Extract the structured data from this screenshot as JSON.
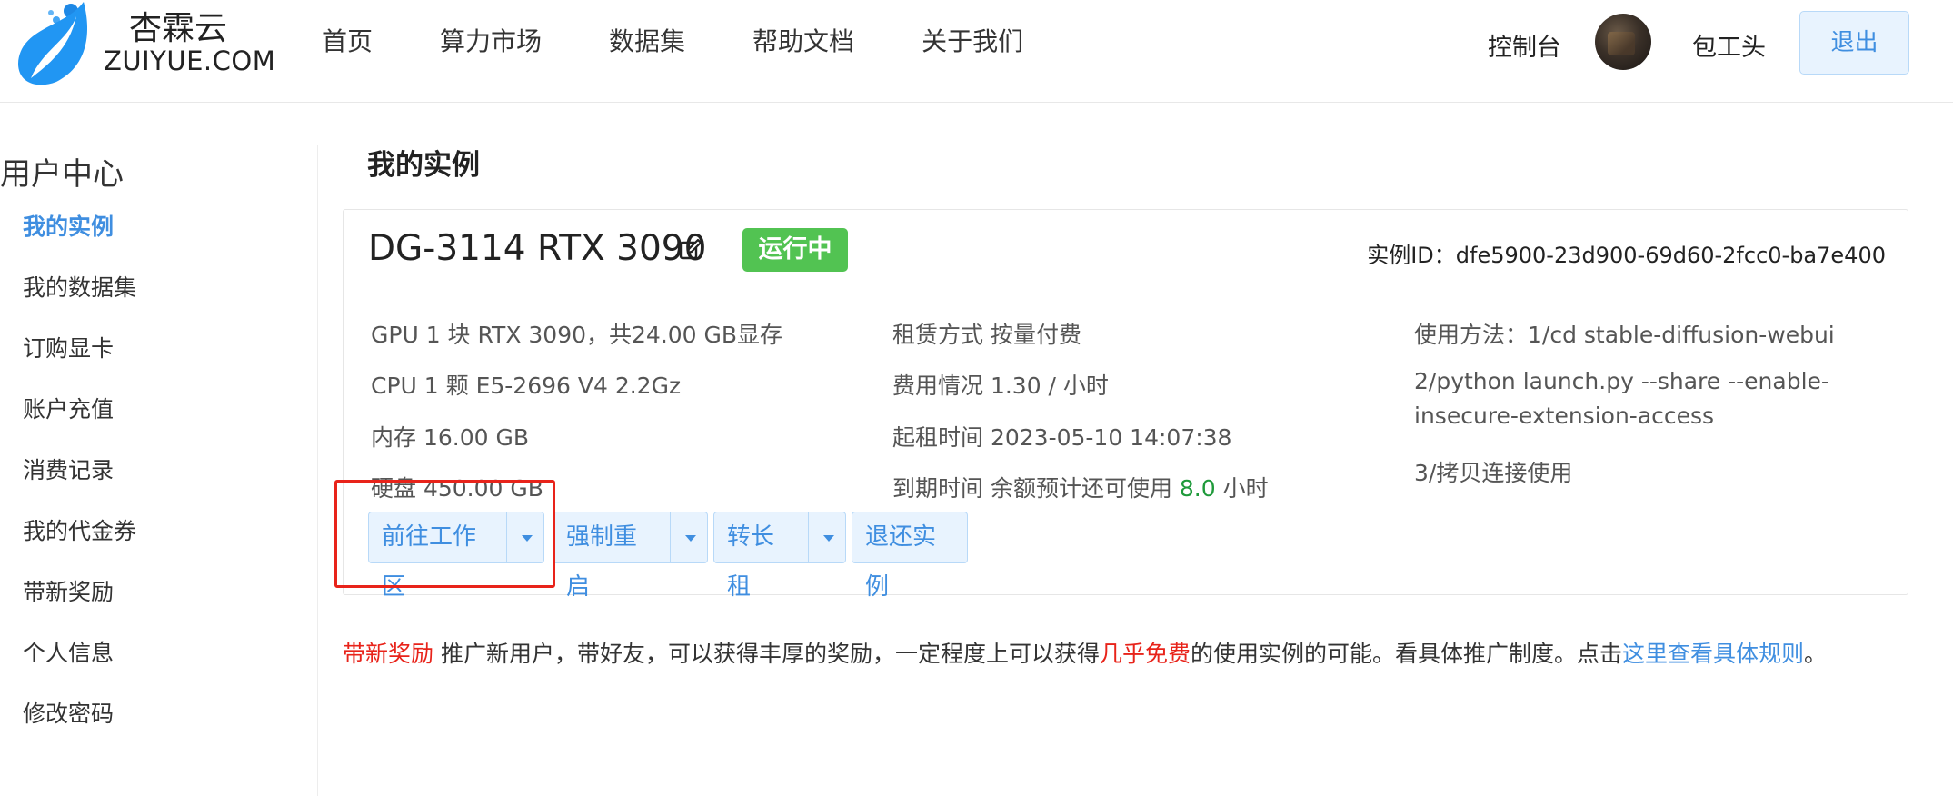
{
  "header": {
    "logo_cn": "杏霖云",
    "logo_en": "ZUIYUE.COM",
    "nav": [
      "首页",
      "算力市场",
      "数据集",
      "帮助文档",
      "关于我们"
    ],
    "console_label": "控制台",
    "username": "包工头",
    "logout_label": "退出"
  },
  "sidebar": {
    "title": "用户中心",
    "items": [
      {
        "label": "我的实例",
        "active": true
      },
      {
        "label": "我的数据集"
      },
      {
        "label": "订购显卡"
      },
      {
        "label": "账户充值"
      },
      {
        "label": "消费记录"
      },
      {
        "label": "我的代金券"
      },
      {
        "label": "带新奖励"
      },
      {
        "label": "个人信息"
      },
      {
        "label": "修改密码"
      }
    ]
  },
  "main": {
    "page_title": "我的实例",
    "instance": {
      "name": "DG-3114 RTX 3090",
      "status": "运行中",
      "id_label": "实例ID：dfe5900-23d900-69d60-2fcc0-ba7e400",
      "specs": {
        "gpu": "GPU 1 块 RTX 3090，共24.00 GB显存",
        "cpu": "CPU 1 颗 E5-2696 V4 2.2Gz",
        "memory": "内存 16.00 GB",
        "disk": "硬盘 450.00 GB"
      },
      "billing": {
        "mode": "租赁方式 按量付费",
        "cost": "费用情况 1.30 / 小时",
        "start": "起租时间 2023-05-10 14:07:38",
        "expire_prefix": "到期时间 余额预计还可使用 ",
        "expire_value": "8.0",
        "expire_suffix": " 小时"
      },
      "usage": {
        "line1": "使用方法：1/cd stable-diffusion-webui",
        "line2a": "2/python launch.py --share --enable-",
        "line2b": "insecure-extension-access",
        "line3": "3/拷贝连接使用"
      },
      "buttons": {
        "workspace": "前往工作区",
        "restart": "强制重启",
        "long_term": "转长租",
        "return": "退还实例"
      }
    },
    "promo": {
      "tag": "带新奖励",
      "text1": " 推广新用户，带好友，可以获得丰厚的奖励，一定程度上可以获得",
      "highlight": "几乎免费",
      "text2": "的使用实例的可能。看具体推广制度。点击",
      "link": "这里查看具体规则",
      "end": "。"
    }
  },
  "colors": {
    "accent": "#3f8ee0",
    "status_green": "#52c352",
    "highlight_red": "#e8231a"
  }
}
